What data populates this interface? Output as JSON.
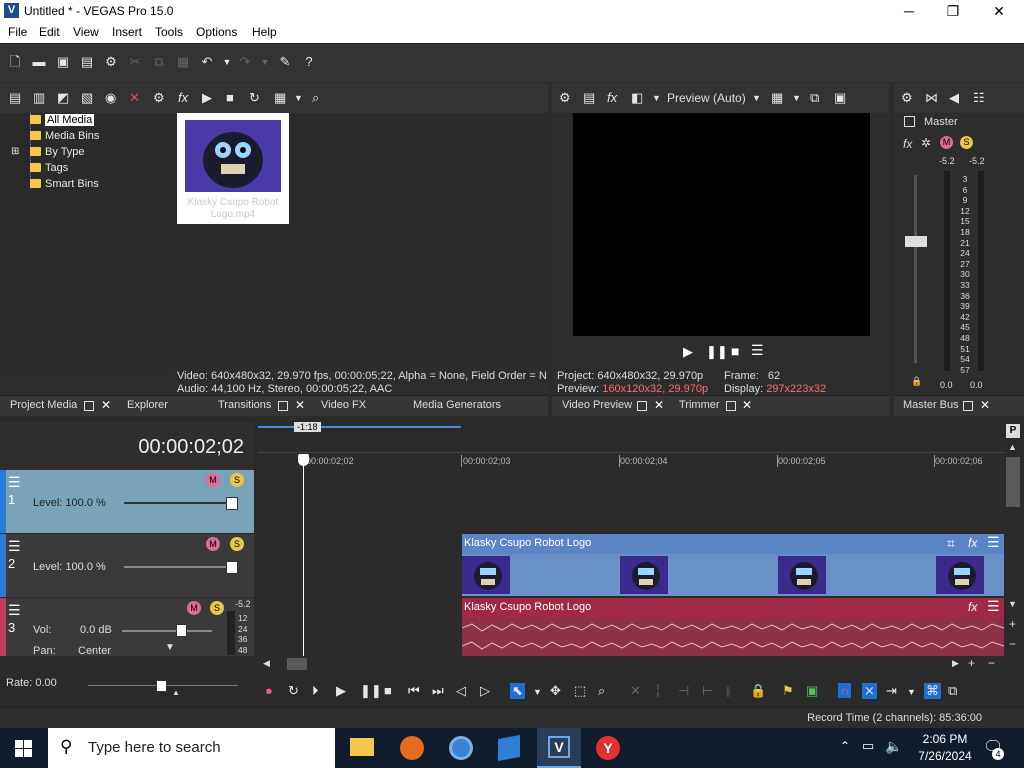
{
  "window": {
    "title": "Untitled * - VEGAS Pro 15.0",
    "logo_letter": "V",
    "minimize": "─",
    "maximize": "❐",
    "close": "✕"
  },
  "menu": [
    "File",
    "Edit",
    "View",
    "Insert",
    "Tools",
    "Options",
    "Help"
  ],
  "project_media": {
    "tree": [
      {
        "label": "All Media",
        "selected": true
      },
      {
        "label": "Media Bins"
      },
      {
        "label": "By Type",
        "expandable": true
      },
      {
        "label": "Tags"
      },
      {
        "label": "Smart Bins"
      }
    ],
    "thumbnail_label": "Klasky Csupo Robot Logo.mp4",
    "info_video": "Video: 640x480x32, 29.970 fps, 00:00:05;22, Alpha = None, Field Order = N",
    "info_audio": "Audio: 44,100 Hz, Stereo, 00:00:05;22, AAC",
    "tabs": [
      "Project Media",
      "Explorer",
      "Transitions",
      "Video FX",
      "Media Generators"
    ]
  },
  "preview": {
    "mode_label": "Preview (Auto)",
    "project_label": "Project:",
    "project_value": "640x480x32, 29.970p",
    "preview_label": "Preview:",
    "preview_value": "160x120x32, 29.970p",
    "frame_label": "Frame:",
    "frame_value": "62",
    "display_label": "Display:",
    "display_value": "297x223x32",
    "tabs": [
      "Video Preview",
      "Trimmer"
    ]
  },
  "master": {
    "title": "Master",
    "peak_left": "-5.2",
    "peak_right": "-5.2",
    "scale": [
      "3",
      "6",
      "9",
      "12",
      "15",
      "18",
      "21",
      "24",
      "27",
      "30",
      "33",
      "36",
      "39",
      "42",
      "45",
      "48",
      "51",
      "54",
      "57"
    ],
    "bottom_left": "0.0",
    "bottom_right": "0.0",
    "tab": "Master Bus"
  },
  "timeline": {
    "timecode": "00:00:02;02",
    "marker": "-1:18",
    "ruler": [
      "00:00:02;02",
      "00:00:02;03",
      "00:00:02;04",
      "00:00:02;05",
      "00:00:02;06"
    ],
    "tracks": [
      {
        "num": "1",
        "level": "Level: 100.0 %"
      },
      {
        "num": "2",
        "level": "Level: 100.0 %"
      },
      {
        "num": "3",
        "vol_label": "Vol:",
        "vol_value": "0.0 dB",
        "pan_label": "Pan:",
        "pan_value": "Center",
        "peak": "-5.2",
        "scale": [
          "12",
          "24",
          "36",
          "48"
        ]
      }
    ],
    "video_event": "Klasky Csupo Robot Logo",
    "audio_event": "Klasky Csupo Robot Logo",
    "rate": "Rate: 0.00",
    "status": "Record Time (2 channels): 85:36:00"
  },
  "taskbar": {
    "search_placeholder": "Type here to search",
    "time": "2:06 PM",
    "date": "7/26/2024",
    "notifications": "4"
  },
  "colors": {
    "track1": "#7aa3b8",
    "video_event": "#5a84c6",
    "audio_event": "#a02a45",
    "accent": "#1d6fd6"
  }
}
